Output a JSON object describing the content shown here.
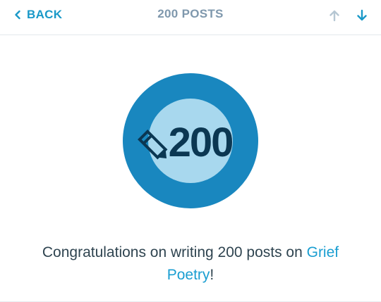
{
  "header": {
    "back_label": "BACK",
    "title": "200 POSTS"
  },
  "badge": {
    "number": "200",
    "outer_color": "#1987bf",
    "inner_color": "#a8d8ee",
    "text_color": "#0b3752"
  },
  "message": {
    "prefix": "Congratulations on writing 200 posts on ",
    "link_text": "Grief Poetry",
    "suffix": "!"
  },
  "colors": {
    "accent": "#1a99c8",
    "title": "#7f98ad",
    "up_disabled": "#b6c7d3"
  }
}
